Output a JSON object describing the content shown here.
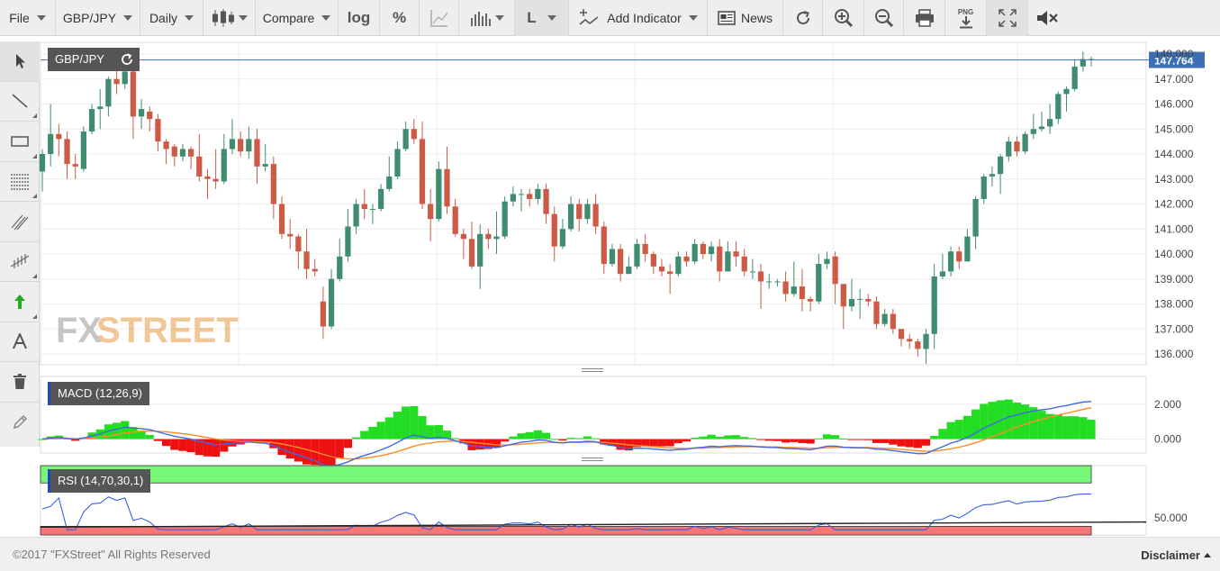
{
  "toolbar": {
    "file": "File",
    "symbol": "GBP/JPY",
    "period": "Daily",
    "compare": "Compare",
    "log": "log",
    "percent": "%",
    "line_style": "L",
    "add_indicator": "Add Indicator",
    "news": "News",
    "png": "PNG"
  },
  "logo": {
    "fx": "FX",
    "street": "STREET"
  },
  "footer": {
    "copyright": "©2017 \"FXStreet\" All Rights Reserved",
    "disclaimer": "Disclaimer"
  },
  "colors": {
    "up": "#3f8c70",
    "down": "#cc5a45",
    "macd": "#4169e1",
    "signal": "#ff8c28",
    "hist_up": "#22dd22",
    "hist_down": "#ee1111",
    "rsi_over": "#77f777",
    "rsi_under": "#f77777"
  },
  "chart_data": [
    {
      "type": "candlestick",
      "title": "GBP/JPY",
      "last_price": "147.764",
      "ylim": [
        135.6,
        148.1
      ],
      "y_ticks": [
        "136.000",
        "137.000",
        "138.000",
        "139.000",
        "140.000",
        "141.000",
        "142.000",
        "143.000",
        "144.000",
        "145.000",
        "146.000",
        "147.000",
        "148.000"
      ],
      "grid": true,
      "candles": [
        [
          143.3,
          144.0,
          142.5,
          144.2
        ],
        [
          144.0,
          144.8,
          143.5,
          146.0
        ],
        [
          144.8,
          144.6,
          143.9,
          145.2
        ],
        [
          144.6,
          143.6,
          143.0,
          144.9
        ],
        [
          143.6,
          143.5,
          143.0,
          144.0
        ],
        [
          143.4,
          144.9,
          143.3,
          145.1
        ],
        [
          144.9,
          145.8,
          144.8,
          146.0
        ],
        [
          145.8,
          145.9,
          145.0,
          146.6
        ],
        [
          145.9,
          147.0,
          145.5,
          147.1
        ],
        [
          147.0,
          146.8,
          146.4,
          147.5
        ],
        [
          146.8,
          147.3,
          146.6,
          147.6
        ],
        [
          147.3,
          145.5,
          144.6,
          148.0
        ],
        [
          145.5,
          145.8,
          145.0,
          146.2
        ],
        [
          145.7,
          145.4,
          144.9,
          145.9
        ],
        [
          145.4,
          144.5,
          144.1,
          145.6
        ],
        [
          144.5,
          144.2,
          143.6,
          144.6
        ],
        [
          144.3,
          143.9,
          143.5,
          144.4
        ],
        [
          143.9,
          144.2,
          143.7,
          144.4
        ],
        [
          144.2,
          143.9,
          143.4,
          144.3
        ],
        [
          143.9,
          143.1,
          142.9,
          144.8
        ],
        [
          143.1,
          143.0,
          142.2,
          143.4
        ],
        [
          143.0,
          142.9,
          142.6,
          144.2
        ],
        [
          142.9,
          144.2,
          142.8,
          144.8
        ],
        [
          144.2,
          144.6,
          144.0,
          145.4
        ],
        [
          144.6,
          144.1,
          143.9,
          144.9
        ],
        [
          144.1,
          144.6,
          143.8,
          145.1
        ],
        [
          144.6,
          143.5,
          142.8,
          145.0
        ],
        [
          143.5,
          143.6,
          143.3,
          144.4
        ],
        [
          143.6,
          142.0,
          141.4,
          143.9
        ],
        [
          142.0,
          140.8,
          140.6,
          142.3
        ],
        [
          140.8,
          140.7,
          140.2,
          141.4
        ],
        [
          140.7,
          140.1,
          139.4,
          140.8
        ],
        [
          140.1,
          139.4,
          139.0,
          141.0
        ],
        [
          139.4,
          139.3,
          139.1,
          139.8
        ],
        [
          138.1,
          137.1,
          136.6,
          138.7
        ],
        [
          137.1,
          139.0,
          137.0,
          139.4
        ],
        [
          139.0,
          139.9,
          138.9,
          140.6
        ],
        [
          139.9,
          141.1,
          139.7,
          141.8
        ],
        [
          141.1,
          142.0,
          140.8,
          142.2
        ],
        [
          142.0,
          141.8,
          141.4,
          142.6
        ],
        [
          141.8,
          141.8,
          141.2,
          142.0
        ],
        [
          141.8,
          142.6,
          141.7,
          142.8
        ],
        [
          142.6,
          143.1,
          142.5,
          143.9
        ],
        [
          143.1,
          144.2,
          143.0,
          144.5
        ],
        [
          144.2,
          145.0,
          144.1,
          145.3
        ],
        [
          145.0,
          144.6,
          144.4,
          145.4
        ],
        [
          144.6,
          142.0,
          141.8,
          145.3
        ],
        [
          142.0,
          141.4,
          140.5,
          142.6
        ],
        [
          141.4,
          143.4,
          141.3,
          143.7
        ],
        [
          143.4,
          141.9,
          141.6,
          144.3
        ],
        [
          141.9,
          140.8,
          140.7,
          142.2
        ],
        [
          140.8,
          140.6,
          139.8,
          141.0
        ],
        [
          140.6,
          139.5,
          139.4,
          141.3
        ],
        [
          139.5,
          140.8,
          138.6,
          141.2
        ],
        [
          140.8,
          140.6,
          140.2,
          141.0
        ],
        [
          140.6,
          140.7,
          140.0,
          141.7
        ],
        [
          140.7,
          142.1,
          140.6,
          142.3
        ],
        [
          142.1,
          142.4,
          141.9,
          142.7
        ],
        [
          142.4,
          142.4,
          141.7,
          142.6
        ],
        [
          142.4,
          142.2,
          141.9,
          142.6
        ],
        [
          142.2,
          142.6,
          142.0,
          142.8
        ],
        [
          142.6,
          141.6,
          141.2,
          142.8
        ],
        [
          141.6,
          140.3,
          139.7,
          141.9
        ],
        [
          140.3,
          141.0,
          140.2,
          141.4
        ],
        [
          141.0,
          142.0,
          140.9,
          142.3
        ],
        [
          142.0,
          141.4,
          140.9,
          142.2
        ],
        [
          141.4,
          142.0,
          141.2,
          142.2
        ],
        [
          142.0,
          141.1,
          140.8,
          142.4
        ],
        [
          141.1,
          139.6,
          139.2,
          141.3
        ],
        [
          139.6,
          140.2,
          139.5,
          140.4
        ],
        [
          140.2,
          139.2,
          138.9,
          140.4
        ],
        [
          139.2,
          139.5,
          139.3,
          139.9
        ],
        [
          139.5,
          140.4,
          139.4,
          140.6
        ],
        [
          140.4,
          140.0,
          139.7,
          140.8
        ],
        [
          140.0,
          139.5,
          139.2,
          140.1
        ],
        [
          139.5,
          139.3,
          139.1,
          139.8
        ],
        [
          139.3,
          139.2,
          138.4,
          139.6
        ],
        [
          139.2,
          139.9,
          139.1,
          140.1
        ],
        [
          139.9,
          139.7,
          139.5,
          140.1
        ],
        [
          139.7,
          140.4,
          139.6,
          140.6
        ],
        [
          140.4,
          140.0,
          139.8,
          140.5
        ],
        [
          140.0,
          140.3,
          139.7,
          140.5
        ],
        [
          140.3,
          139.3,
          138.9,
          140.6
        ],
        [
          139.3,
          140.1,
          139.3,
          140.5
        ],
        [
          140.1,
          139.9,
          139.5,
          140.5
        ],
        [
          139.9,
          139.3,
          139.1,
          140.2
        ],
        [
          139.3,
          139.3,
          139.0,
          139.8
        ],
        [
          139.3,
          138.9,
          137.8,
          139.6
        ],
        [
          138.9,
          138.9,
          138.6,
          139.2
        ],
        [
          138.9,
          138.9,
          138.7,
          139.0
        ],
        [
          138.9,
          138.4,
          138.1,
          139.3
        ],
        [
          138.4,
          138.7,
          138.3,
          139.7
        ],
        [
          138.7,
          138.2,
          137.7,
          139.4
        ],
        [
          138.2,
          138.1,
          137.7,
          138.3
        ],
        [
          138.1,
          139.6,
          138.0,
          140.0
        ],
        [
          139.6,
          139.8,
          139.4,
          140.1
        ],
        [
          139.9,
          138.8,
          138.0,
          140.1
        ],
        [
          138.8,
          137.9,
          137.0,
          138.7
        ],
        [
          137.9,
          138.2,
          137.7,
          139.0
        ],
        [
          138.2,
          138.2,
          137.4,
          138.6
        ],
        [
          138.2,
          138.1,
          137.9,
          138.4
        ],
        [
          138.1,
          137.2,
          137.0,
          138.3
        ],
        [
          137.2,
          137.6,
          137.1,
          137.8
        ],
        [
          137.6,
          137.0,
          136.8,
          137.8
        ],
        [
          137.0,
          136.6,
          136.3,
          137.0
        ],
        [
          136.6,
          136.5,
          136.2,
          136.8
        ],
        [
          136.5,
          136.2,
          135.9,
          136.6
        ],
        [
          136.2,
          136.8,
          135.6,
          137.0
        ],
        [
          136.8,
          139.1,
          136.2,
          139.6
        ],
        [
          139.1,
          139.3,
          139.0,
          140.0
        ],
        [
          139.3,
          140.1,
          139.1,
          140.3
        ],
        [
          140.1,
          139.7,
          139.4,
          140.3
        ],
        [
          139.7,
          140.7,
          139.7,
          141.0
        ],
        [
          140.7,
          142.2,
          140.2,
          142.3
        ],
        [
          142.2,
          143.1,
          142.0,
          143.2
        ],
        [
          143.1,
          143.2,
          142.7,
          143.5
        ],
        [
          143.2,
          143.9,
          142.4,
          144.0
        ],
        [
          143.9,
          144.5,
          143.7,
          144.7
        ],
        [
          144.5,
          144.1,
          143.9,
          144.7
        ],
        [
          144.1,
          144.8,
          144.0,
          144.9
        ],
        [
          144.8,
          145.0,
          144.6,
          145.6
        ],
        [
          145.0,
          145.1,
          144.9,
          145.7
        ],
        [
          145.1,
          145.4,
          144.8,
          146.0
        ],
        [
          145.4,
          146.4,
          145.2,
          146.5
        ],
        [
          146.4,
          146.6,
          145.7,
          146.7
        ],
        [
          146.6,
          147.5,
          146.5,
          147.8
        ],
        [
          147.5,
          147.8,
          147.3,
          148.1
        ],
        [
          147.8,
          147.8,
          147.5,
          147.9
        ]
      ]
    },
    {
      "type": "line",
      "title": "MACD (12,26,9)",
      "y_ticks": [
        "2.000",
        "0.000"
      ],
      "ylim": [
        -0.8,
        3.6
      ]
    },
    {
      "type": "line",
      "title": "RSI (14,70,30,1)",
      "y_ticks": [
        "50.000"
      ],
      "ylim": [
        40,
        80
      ]
    }
  ]
}
